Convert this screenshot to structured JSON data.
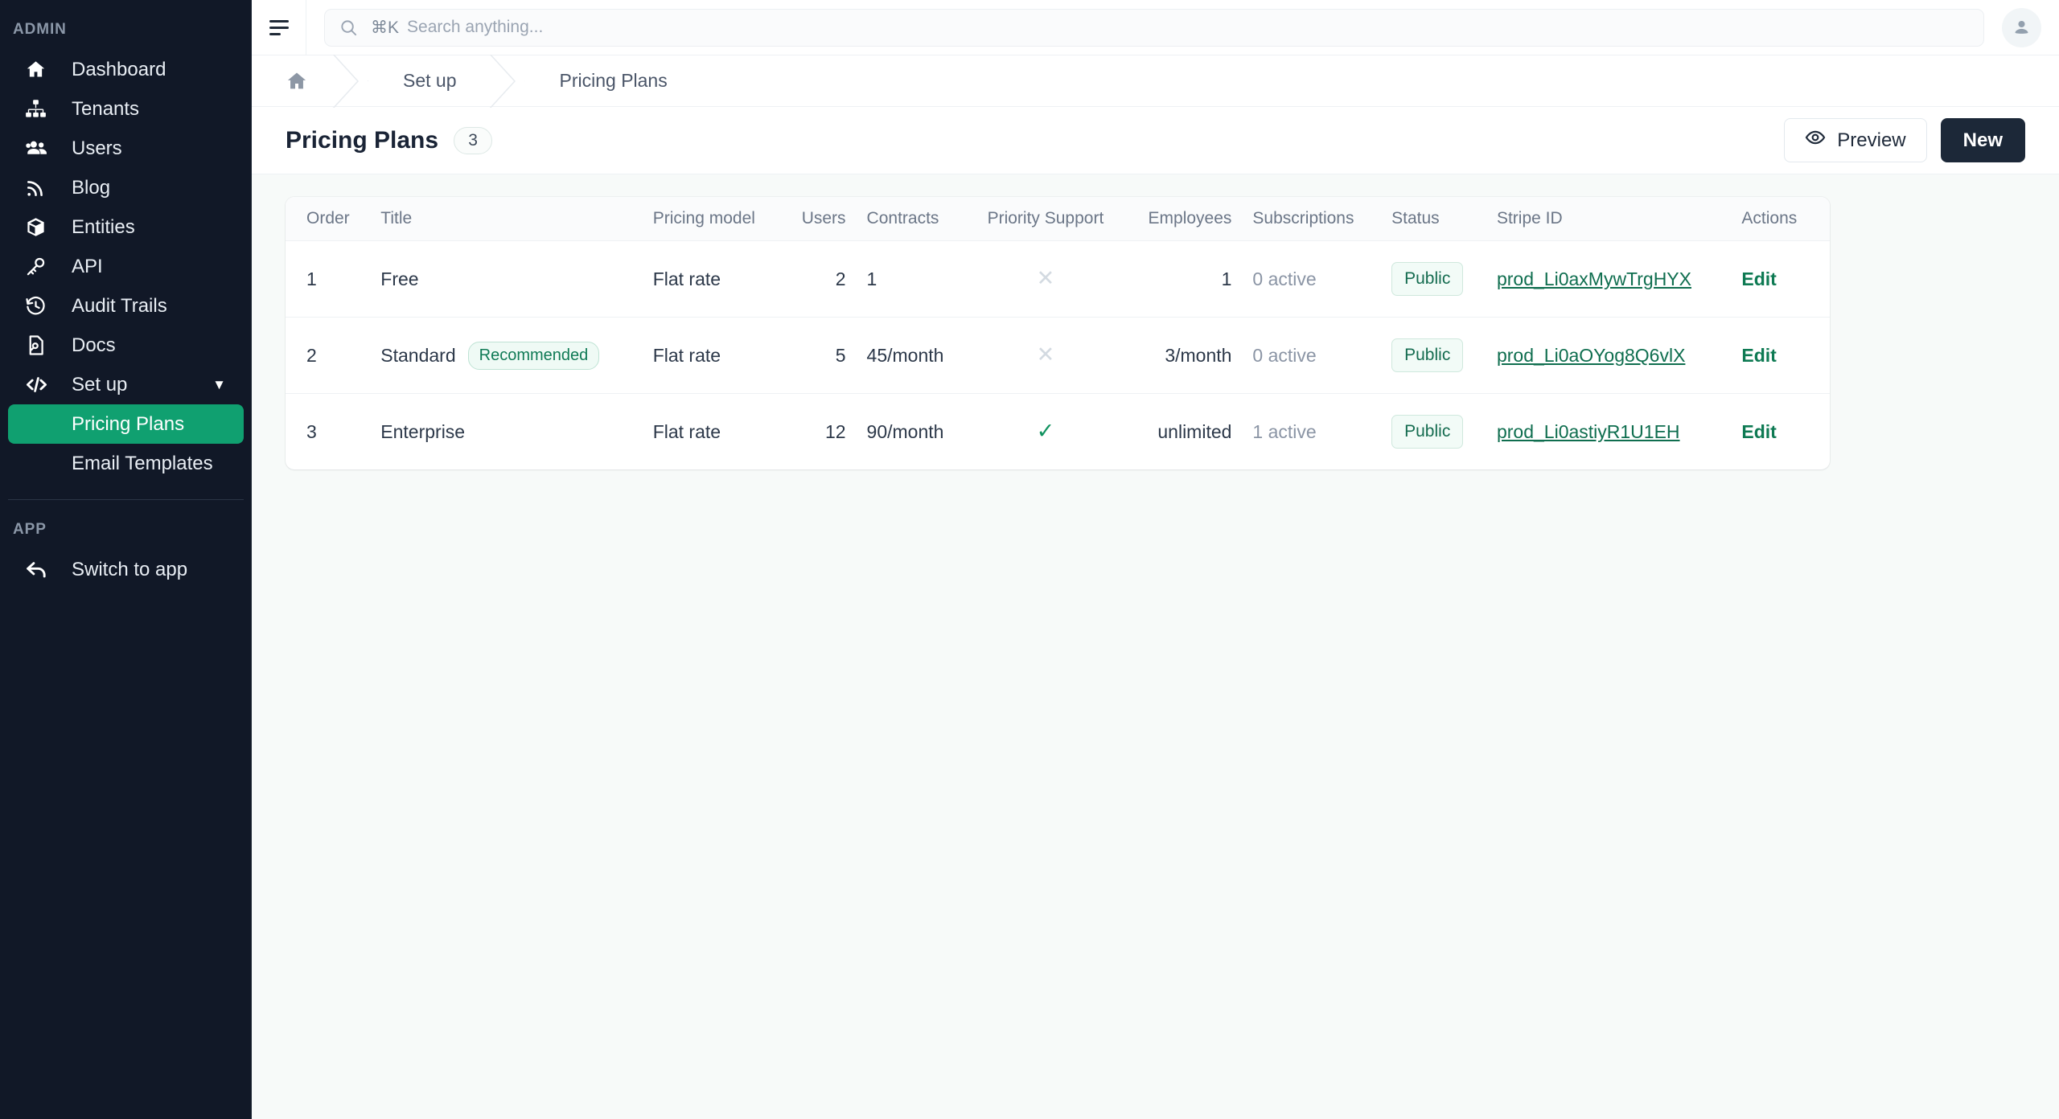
{
  "sidebar": {
    "admin_label": "ADMIN",
    "app_label": "APP",
    "items": [
      {
        "label": "Dashboard",
        "icon": "home-icon"
      },
      {
        "label": "Tenants",
        "icon": "sitemap-icon"
      },
      {
        "label": "Users",
        "icon": "users-icon"
      },
      {
        "label": "Blog",
        "icon": "rss-icon"
      },
      {
        "label": "Entities",
        "icon": "cube-icon"
      },
      {
        "label": "API",
        "icon": "key-icon"
      },
      {
        "label": "Audit Trails",
        "icon": "history-icon"
      },
      {
        "label": "Docs",
        "icon": "document-search-icon"
      },
      {
        "label": "Set up",
        "icon": "code-icon",
        "expander": "▼"
      }
    ],
    "sub_items": [
      {
        "label": "Pricing Plans",
        "active": true
      },
      {
        "label": "Email Templates",
        "active": false
      }
    ],
    "app_items": [
      {
        "label": "Switch to app",
        "icon": "arrow-back-icon"
      }
    ],
    "active_color": "#10a070"
  },
  "topbar": {
    "menu_icon": "hamburger-icon",
    "search": {
      "icon": "search-icon",
      "shortcut": "⌘K",
      "placeholder": "Search anything...",
      "value": ""
    },
    "avatar_icon": "user-avatar-icon"
  },
  "breadcrumb": {
    "home_icon": "home-icon",
    "items": [
      "Set up",
      "Pricing Plans"
    ]
  },
  "header": {
    "title": "Pricing Plans",
    "count": "3",
    "preview_label": "Preview",
    "preview_icon": "eye-icon",
    "new_label": "New"
  },
  "table": {
    "columns": [
      "Order",
      "Title",
      "Pricing model",
      "Users",
      "Contracts",
      "Priority Support",
      "Employees",
      "Subscriptions",
      "Status",
      "Stripe ID",
      "Actions"
    ],
    "rows": [
      {
        "order": "1",
        "title": "Free",
        "badge": "",
        "pricing_model": "Flat rate",
        "users": "2",
        "contracts": "1",
        "priority_support": "✕",
        "priority_support_on": false,
        "employees": "1",
        "subscriptions": "0 active",
        "status": "Public",
        "stripe_id": "prod_Li0axMywTrgHYX",
        "action": "Edit"
      },
      {
        "order": "2",
        "title": "Standard",
        "badge": "Recommended",
        "pricing_model": "Flat rate",
        "users": "5",
        "contracts": "45/month",
        "priority_support": "✕",
        "priority_support_on": false,
        "employees": "3/month",
        "subscriptions": "0 active",
        "status": "Public",
        "stripe_id": "prod_Li0aOYog8Q6vlX",
        "action": "Edit"
      },
      {
        "order": "3",
        "title": "Enterprise",
        "badge": "",
        "pricing_model": "Flat rate",
        "users": "12",
        "contracts": "90/month",
        "priority_support": "✓",
        "priority_support_on": true,
        "employees": "unlimited",
        "subscriptions": "1 active",
        "status": "Public",
        "stripe_id": "prod_Li0astiyR1U1EH",
        "action": "Edit"
      }
    ]
  },
  "colors": {
    "sidebar_bg": "#111827",
    "accent_green": "#10a070",
    "link_green": "#0f6e4f",
    "dark_button": "#1c2838",
    "page_bg": "#f7faf9"
  }
}
